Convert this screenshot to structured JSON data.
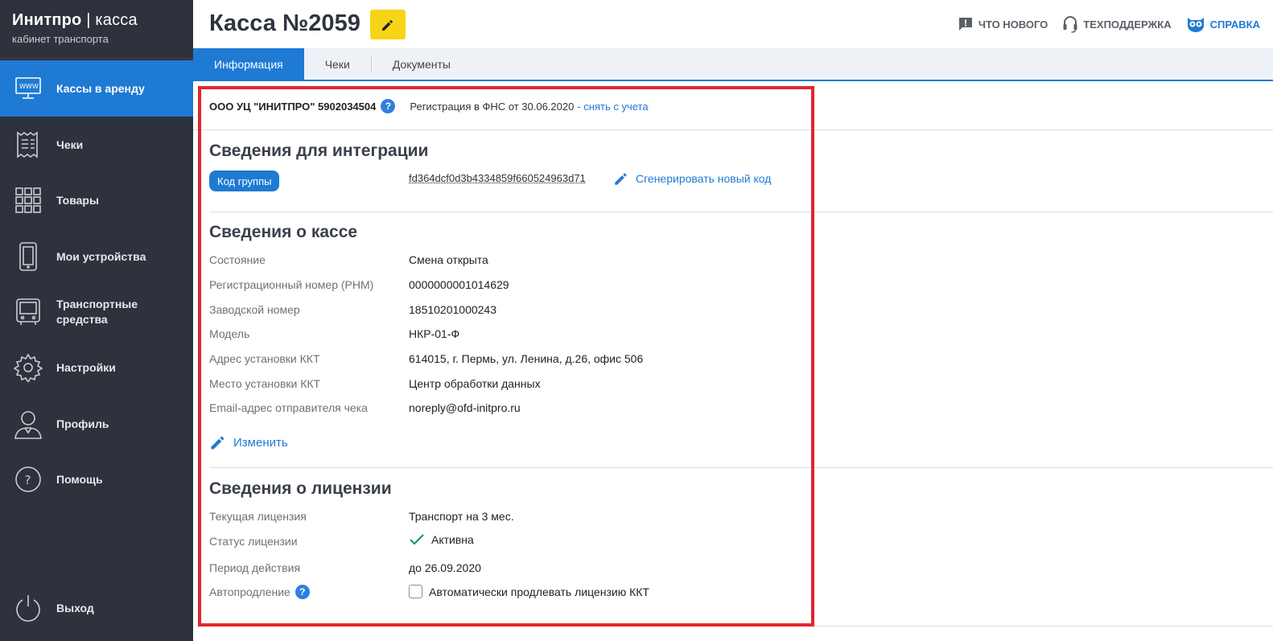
{
  "brand": {
    "name_bold": "Инитпро",
    "separator": " | ",
    "name_thin": "касса",
    "subtitle": "кабинет транспорта"
  },
  "sidebar": {
    "items": [
      {
        "label": "Кассы в аренду",
        "icon": "monitor-www-icon",
        "active": true
      },
      {
        "label": "Чеки",
        "icon": "receipt-icon",
        "active": false
      },
      {
        "label": "Товары",
        "icon": "grid-icon",
        "active": false
      },
      {
        "label": "Мои устройства",
        "icon": "smartphone-icon",
        "active": false
      },
      {
        "label": "Транспортные средства",
        "icon": "bus-icon",
        "active": false
      },
      {
        "label": "Настройки",
        "icon": "gear-icon",
        "active": false
      },
      {
        "label": "Профиль",
        "icon": "user-icon",
        "active": false
      },
      {
        "label": "Помощь",
        "icon": "question-circle-icon",
        "active": false
      }
    ],
    "logout_label": "Выход"
  },
  "header": {
    "title": "Касса №2059",
    "links": {
      "whats_new": "ЧТО НОВОГО",
      "support": "ТЕХПОДДЕРЖКА",
      "help": "СПРАВКА"
    }
  },
  "tabs": [
    "Информация",
    "Чеки",
    "Документы"
  ],
  "org": {
    "name": "ООО УЦ \"ИНИТПРО\" 5902034504",
    "registration": "Регистрация в ФНС от 30.06.2020",
    "deregister_link": "- снять с учета"
  },
  "integration": {
    "title": "Сведения для интеграции",
    "group_code_label": "Код группы",
    "group_code_value": "fd364dcf0d3b4334859f660524963d71",
    "generate_link": "Сгенерировать новый код"
  },
  "register": {
    "title": "Сведения о кассе",
    "rows": [
      {
        "label": "Состояние",
        "value": "Смена открыта"
      },
      {
        "label": "Регистрационный номер (РНМ)",
        "value": "0000000001014629"
      },
      {
        "label": "Заводской номер",
        "value": "18510201000243"
      },
      {
        "label": "Модель",
        "value": "НКР-01-Ф"
      },
      {
        "label": "Адрес установки ККТ",
        "value": "614015, г. Пермь, ул. Ленина, д.26, офис 506"
      },
      {
        "label": "Место установки ККТ",
        "value": "Центр обработки данных"
      },
      {
        "label": "Email-адрес отправителя чека",
        "value": "noreply@ofd-initpro.ru"
      }
    ],
    "change_link": "Изменить"
  },
  "license": {
    "title": "Сведения о лицензии",
    "current_label": "Текущая лицензия",
    "current_value": "Транспорт на 3 мес.",
    "status_label": "Статус лицензии",
    "status_value": "Активна",
    "period_label": "Период действия",
    "period_value": "до 26.09.2020",
    "autorenew_label": "Автопродление",
    "autorenew_checkbox_label": "Автоматически продлевать лицензию ККТ",
    "autorenew_checked": false
  },
  "colors": {
    "sidebar_bg": "#2d323c",
    "accent": "#1f7ad4",
    "edit_button": "#f7d418",
    "highlight": "#e0262f",
    "success": "#1a9a6b"
  }
}
